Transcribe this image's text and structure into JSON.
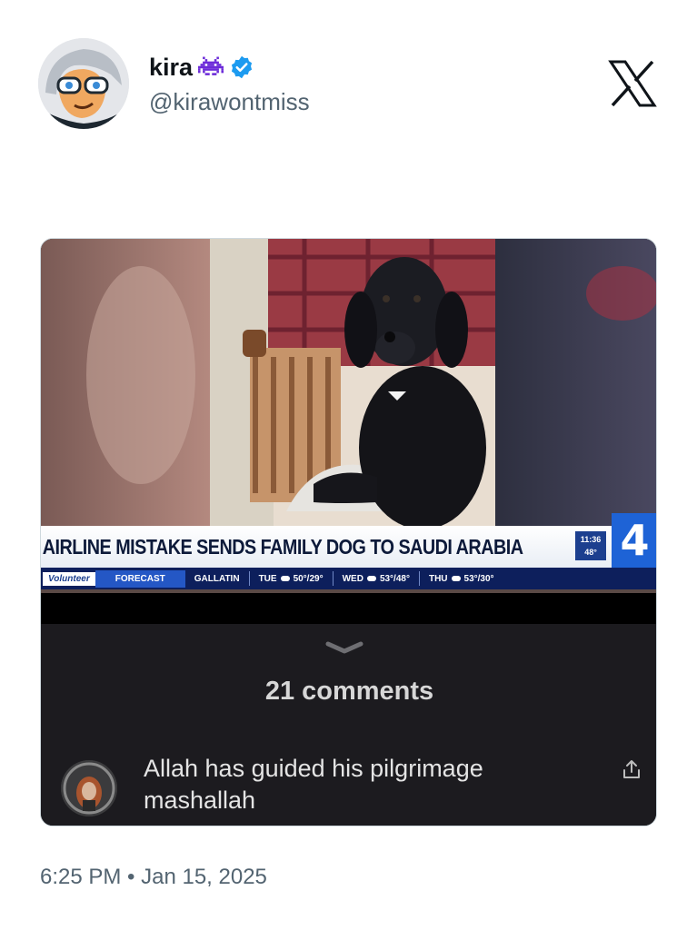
{
  "tweet": {
    "display_name": "kira",
    "name_emoji": "space-invader-icon",
    "verified_icon": "verified-badge-icon",
    "handle": "@kirawontmiss",
    "platform_icon": "x-logo-icon",
    "timestamp": "6:25 PM • Jan 15, 2025"
  },
  "media": {
    "news": {
      "headline": "AIRLINE MISTAKE SENDS FAMILY DOG TO SAUDI ARABIA",
      "time": "11:36",
      "temp": "48°",
      "channel": "4",
      "ticker": {
        "brand": "Volunteer",
        "forecast": "FORECAST",
        "location": "GALLATIN",
        "days": [
          {
            "day": "TUE",
            "temps": "50°/29°"
          },
          {
            "day": "WED",
            "temps": "53°/48°"
          },
          {
            "day": "THU",
            "temps": "53°/30°"
          }
        ]
      }
    },
    "comments": {
      "count_label": "21 comments",
      "expand_icon": "chevron-down-icon",
      "items": [
        {
          "text": "Allah has guided his pilgrimage mashallah",
          "share_icon": "share-icon"
        }
      ]
    }
  },
  "colors": {
    "text_primary": "#0f1419",
    "text_secondary": "#536471",
    "verified": "#1d9bf0",
    "chyron_blue": "#0d1f5c",
    "comments_bg": "#1c1b1f"
  }
}
